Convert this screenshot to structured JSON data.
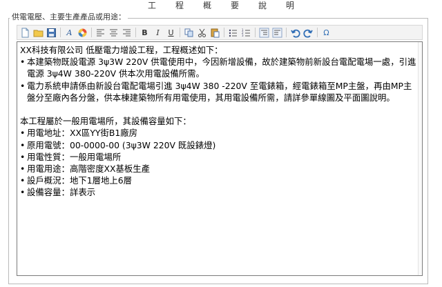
{
  "header": {
    "title": "工程概要說明"
  },
  "field": {
    "legend": "供電電壓、主要生產產品或用途："
  },
  "toolbar": {
    "buttons": [
      {
        "name": "new-document-icon"
      },
      {
        "name": "open-folder-icon"
      },
      {
        "name": "save-icon"
      },
      {
        "sep": true
      },
      {
        "name": "font-style-icon",
        "glyph": "A"
      },
      {
        "name": "color-palette-icon"
      },
      {
        "sep": true
      },
      {
        "name": "align-left-icon"
      },
      {
        "name": "align-center-icon"
      },
      {
        "name": "align-right-icon"
      },
      {
        "sep": true
      },
      {
        "name": "bold-icon",
        "glyph": "B"
      },
      {
        "name": "italic-icon",
        "glyph": "I"
      },
      {
        "name": "underline-icon",
        "glyph": "U"
      },
      {
        "sep": true
      },
      {
        "name": "copy-icon"
      },
      {
        "name": "cut-icon"
      },
      {
        "name": "paste-icon"
      },
      {
        "sep": true
      },
      {
        "name": "unordered-list-icon"
      },
      {
        "name": "ordered-list-icon"
      },
      {
        "sep": true
      },
      {
        "name": "outdent-icon"
      },
      {
        "name": "indent-icon"
      },
      {
        "sep": true
      },
      {
        "name": "undo-icon"
      },
      {
        "name": "redo-icon"
      },
      {
        "sep": true
      },
      {
        "name": "special-character-icon",
        "glyph": "Ω"
      }
    ]
  },
  "editor": {
    "intro": "XX科技有限公司 低壓電力增設工程，工程概述如下：",
    "bullets1": [
      "本建築物既設電源 3ψ3W 220V 供電使用中，今因新增設備，故於建築物前新設台電配電場一處，引進電源 3ψ4W 380-220V 供本次用電設備所需。",
      "電力系統申請係由新設台電配電場引進 3ψ4W 380 -220V 至電錶箱，經電錶箱至MP主盤，再由MP主盤分至廠內各分盤，供本棟建築物所有用電使用，其用電設備所需，請詳參單線圖及平面圖說明。"
    ],
    "capacity_title": "本工程屬於一般用電場所，其設備容量如下：",
    "bullets2": [
      "用電地址：XX區YY街B1廠房",
      "原用電號：00-0000-00 (3ψ3W 220V  既設錶燈)",
      "用電性質：一般用電場所",
      "用電用途：高階密度XX基板生產",
      "設戶概況：地下1層地上6層",
      "設備容量：詳表示"
    ]
  }
}
